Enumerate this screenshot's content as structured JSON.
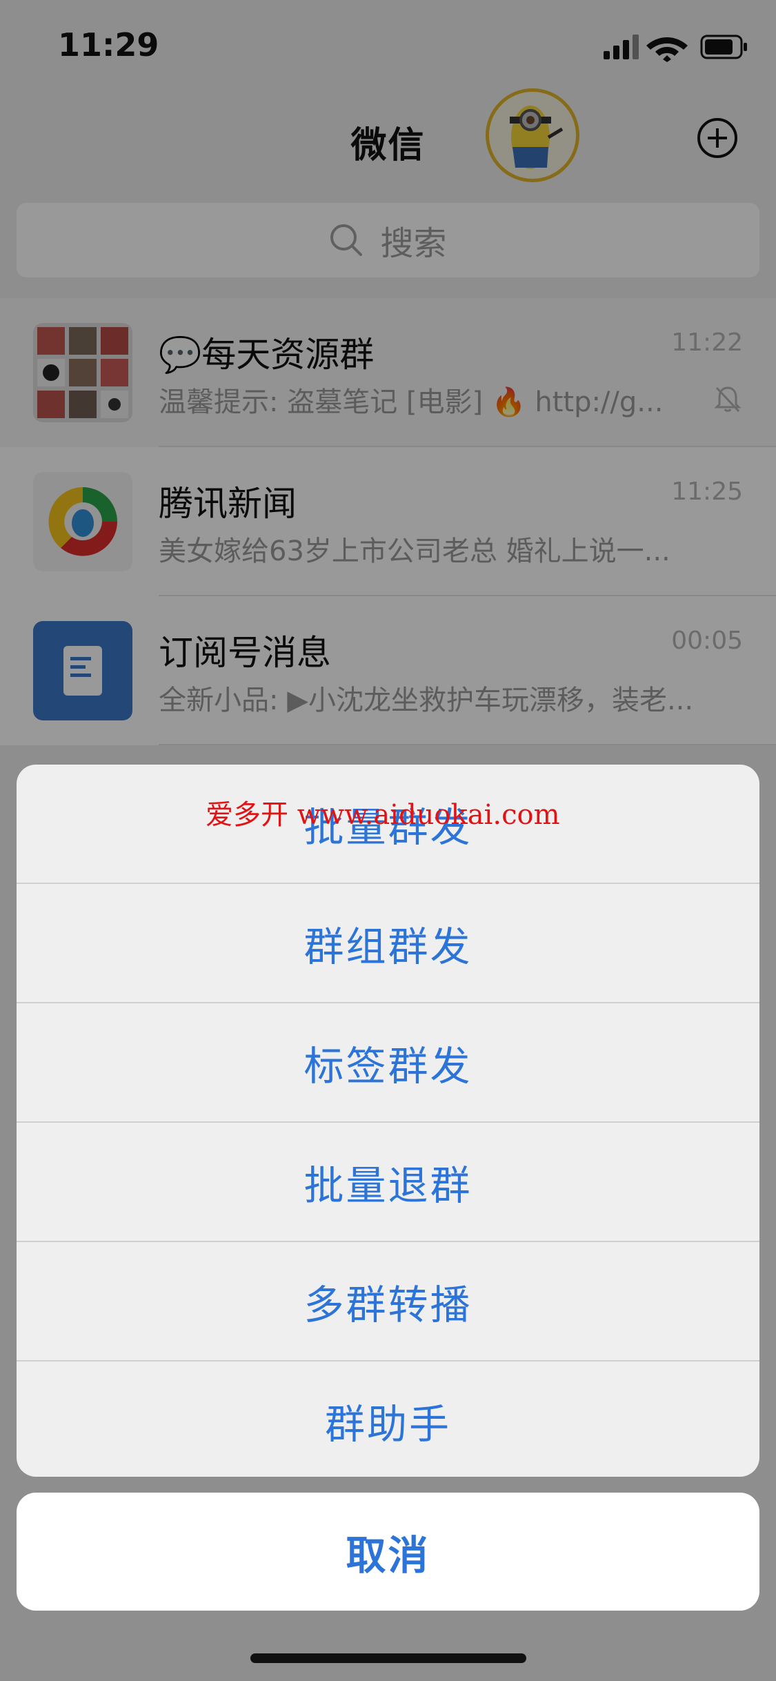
{
  "status_bar": {
    "time": "11:29"
  },
  "nav": {
    "title": "微信"
  },
  "search": {
    "placeholder": "搜索"
  },
  "chats": [
    {
      "title": "💬每天资源群",
      "time": "11:22",
      "preview": "温馨提示: 盗墓笔记 [电影] 🔥 http://g...",
      "muted": true
    },
    {
      "title": "腾讯新闻",
      "time": "11:25",
      "preview": "美女嫁给63岁上市公司老总 婚礼上说一..."
    },
    {
      "title": "订阅号消息",
      "time": "00:05",
      "preview": "全新小品: ▶小沈龙坐救护车玩漂移，装老..."
    }
  ],
  "action_sheet": {
    "items": [
      "批量群发",
      "群组群发",
      "标签群发",
      "批量退群",
      "多群转播",
      "群助手"
    ],
    "cancel": "取消"
  },
  "watermark": "爱多开 www.aiduokai.com",
  "colors": {
    "accent": "#2c74d8",
    "watermark": "#e01414",
    "dim_overlay": "rgba(0,0,0,0.40)"
  }
}
